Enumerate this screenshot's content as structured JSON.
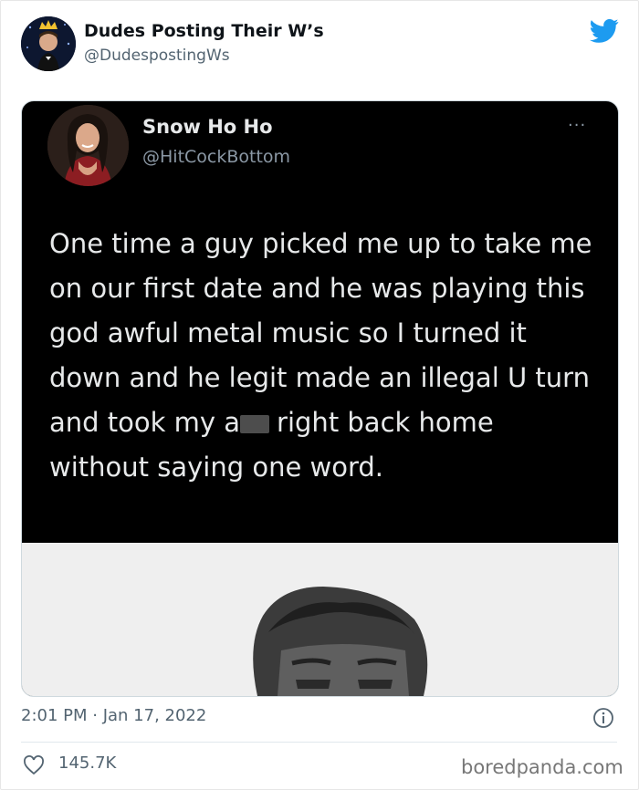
{
  "tweet": {
    "author": {
      "name": "Dudes Posting Their W’s",
      "handle": "@DudespostingWs"
    },
    "timestamp": "2:01 PM · Jan 17, 2022",
    "likes": "145.7K"
  },
  "embedded": {
    "name": "Snow Ho Ho",
    "handle": "@HitCockBottom",
    "more": "···",
    "text_before": "One time a guy picked me up to take me on our first date and he was playing this god awful metal music so I turned it down and he legit made an illegal U turn and took my a",
    "text_after": "right back home without saying one word."
  },
  "watermark": "boredpanda.com",
  "colors": {
    "twitter_blue": "#1d9bf0",
    "muted": "#536471",
    "card_bg": "#000000"
  }
}
